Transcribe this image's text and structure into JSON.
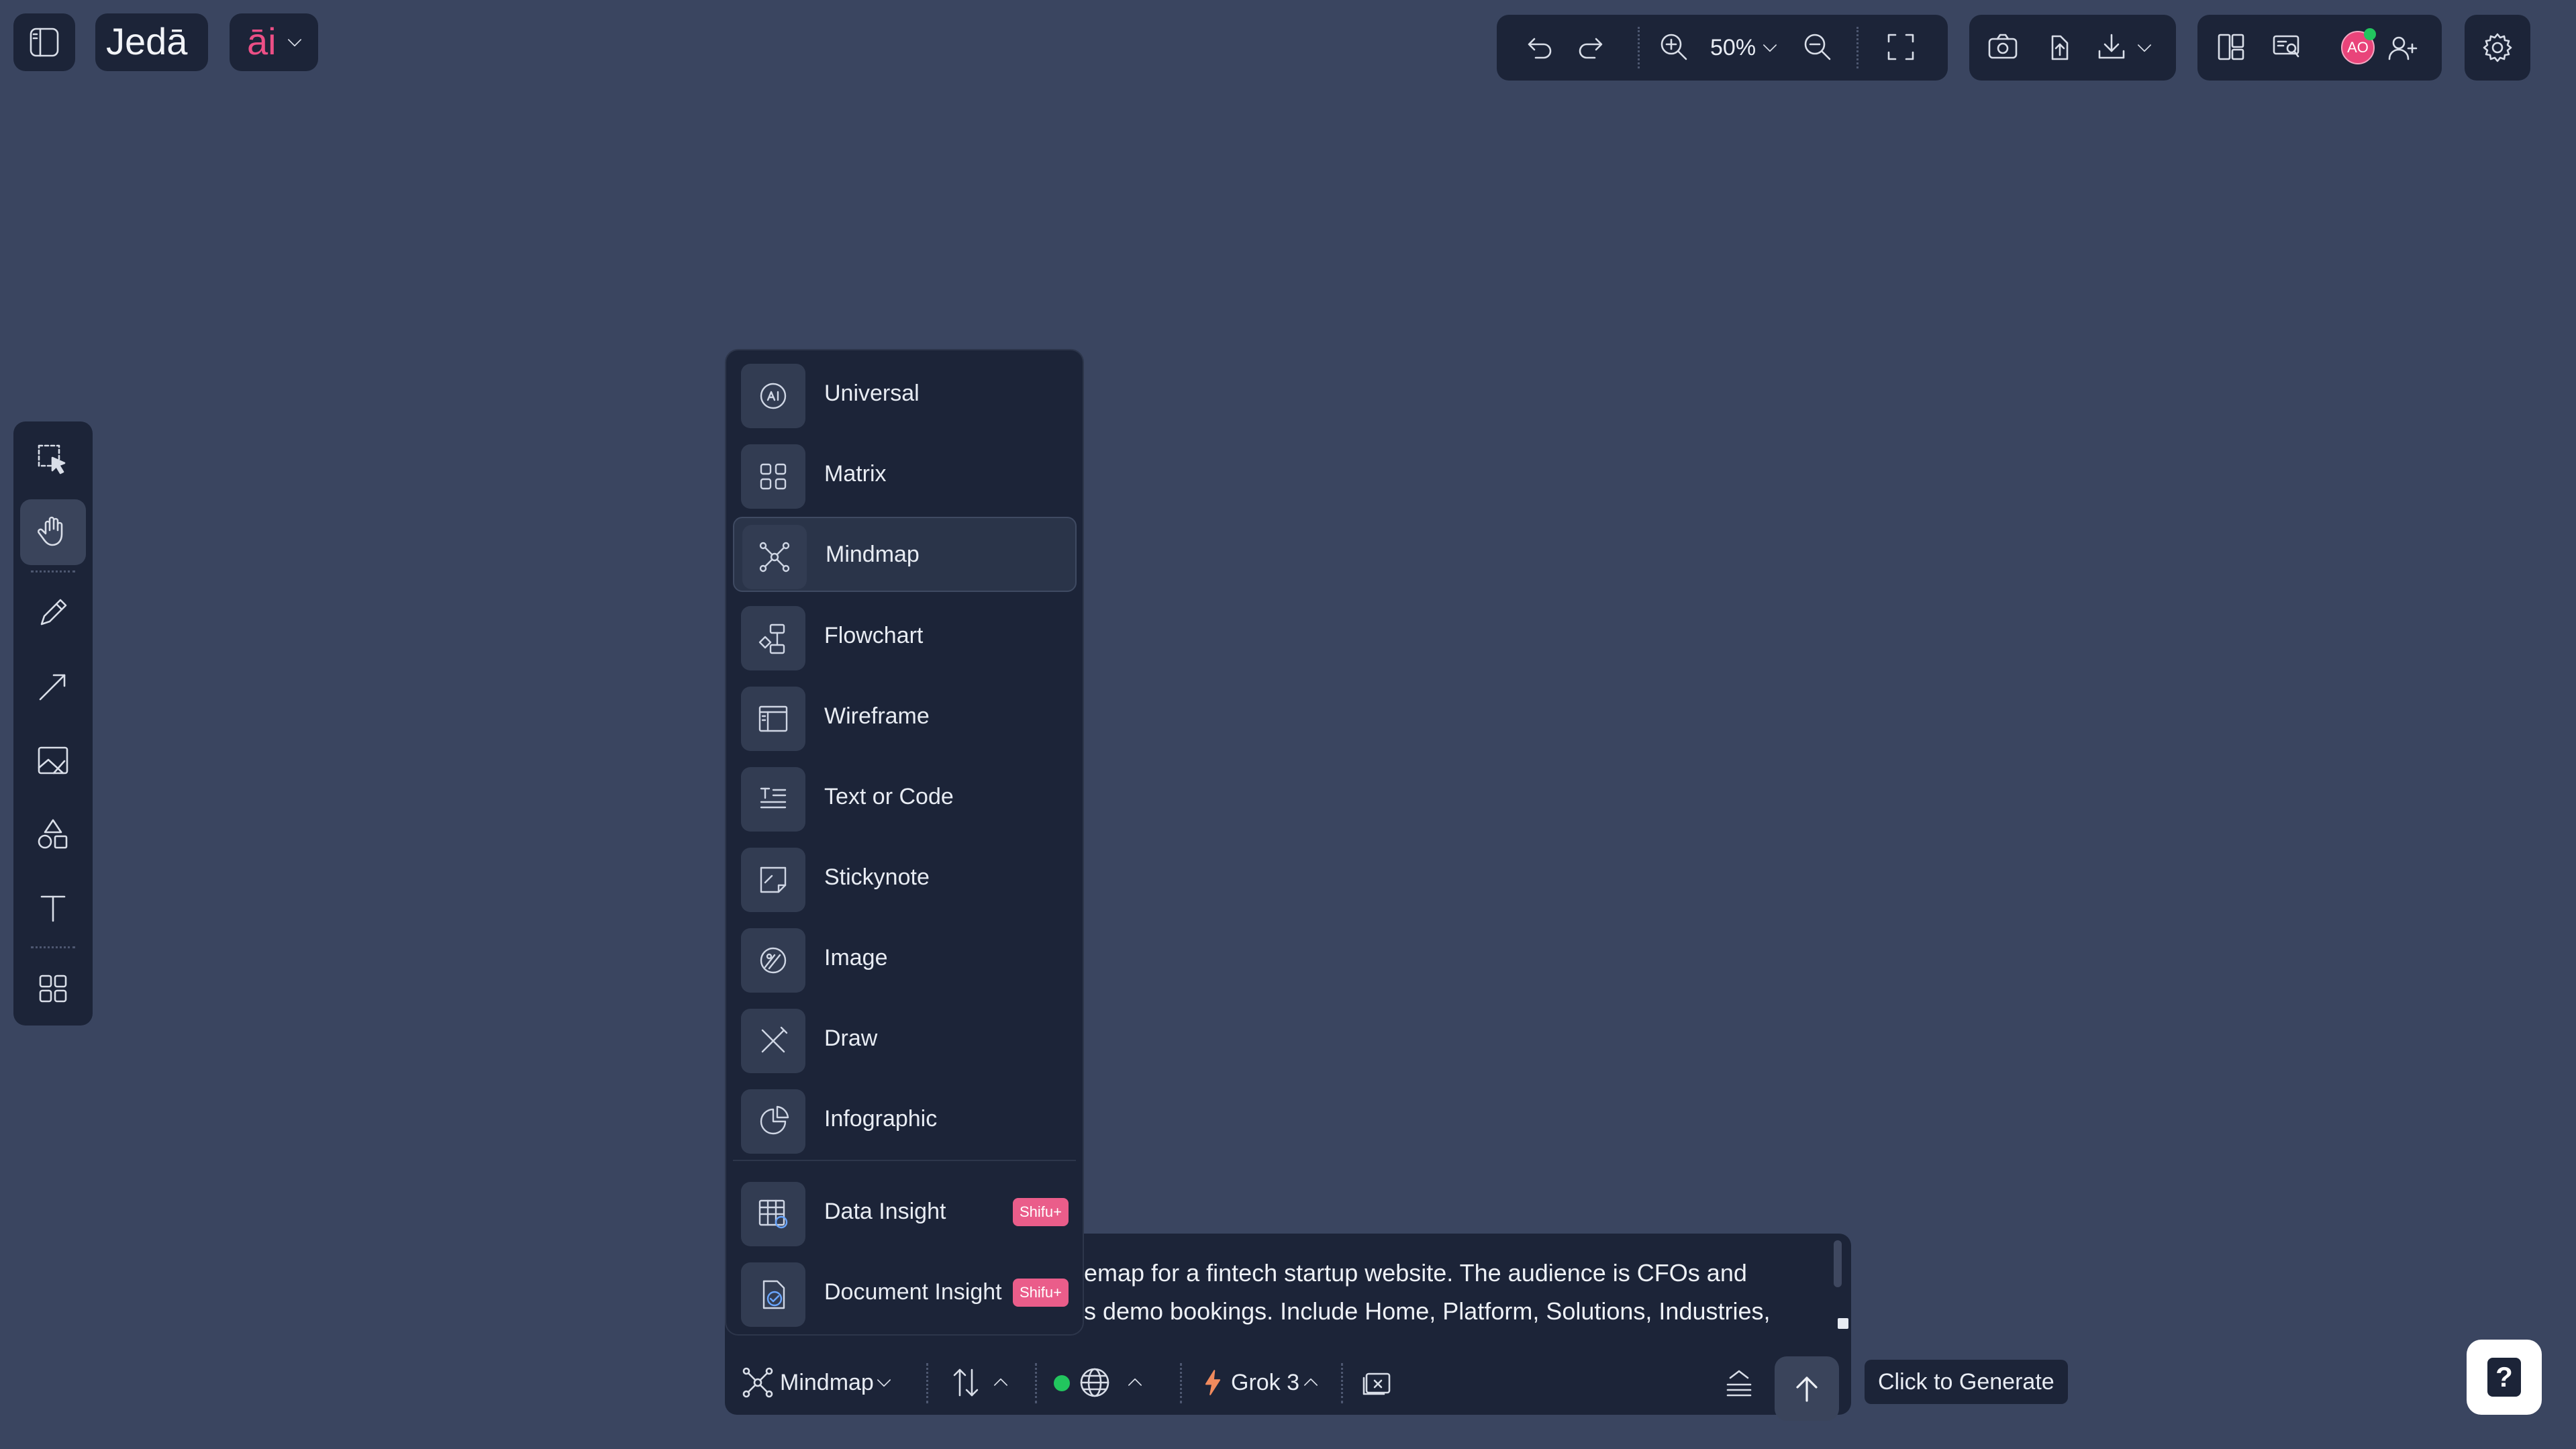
{
  "app": {
    "logo_text": "Jedā",
    "ai_label": "āi"
  },
  "toolbar": {
    "zoom_level": "50%"
  },
  "avatar": {
    "initials": "AO",
    "color": "#e9447a",
    "status_color": "#22c55e"
  },
  "left_tools": [
    {
      "name": "select",
      "icon": "selection-icon"
    },
    {
      "name": "hand",
      "icon": "hand-icon",
      "active": true
    },
    {
      "name": "pencil",
      "icon": "pencil-icon"
    },
    {
      "name": "arrow",
      "icon": "arrow-icon"
    },
    {
      "name": "image",
      "icon": "image-icon"
    },
    {
      "name": "shapes",
      "icon": "shapes-icon"
    },
    {
      "name": "text",
      "icon": "text-icon"
    },
    {
      "name": "apps",
      "icon": "grid-icon"
    }
  ],
  "menu": {
    "items": [
      {
        "label": "Universal",
        "icon": "ai-icon"
      },
      {
        "label": "Matrix",
        "icon": "matrix-icon"
      },
      {
        "label": "Mindmap",
        "icon": "mindmap-icon",
        "selected": true
      },
      {
        "label": "Flowchart",
        "icon": "flowchart-icon"
      },
      {
        "label": "Wireframe",
        "icon": "wireframe-icon"
      },
      {
        "label": "Text or Code",
        "icon": "text-code-icon"
      },
      {
        "label": "Stickynote",
        "icon": "stickynote-icon"
      },
      {
        "label": "Image",
        "icon": "image-icon"
      },
      {
        "label": "Draw",
        "icon": "draw-icon"
      },
      {
        "label": "Infographic",
        "icon": "infographic-icon"
      }
    ],
    "premium_items": [
      {
        "label": "Data Insight",
        "badge": "Shifu+",
        "icon": "data-insight-icon"
      },
      {
        "label": "Document Insight",
        "badge": "Shifu+",
        "icon": "document-insight-icon"
      }
    ],
    "badge_color": "#ea5d8a"
  },
  "prompt": {
    "line1": "emap for a fintech startup website. The audience is CFOs and",
    "line2": "s demo bookings. Include Home, Platform, Solutions, Industries,",
    "line3": "                                                       ",
    "mode_label": "Mindmap",
    "model_label": "Grok 3",
    "web_status_color": "#22c55e"
  },
  "tooltip": {
    "text": "Click to Generate"
  },
  "help": {
    "label": "?"
  }
}
